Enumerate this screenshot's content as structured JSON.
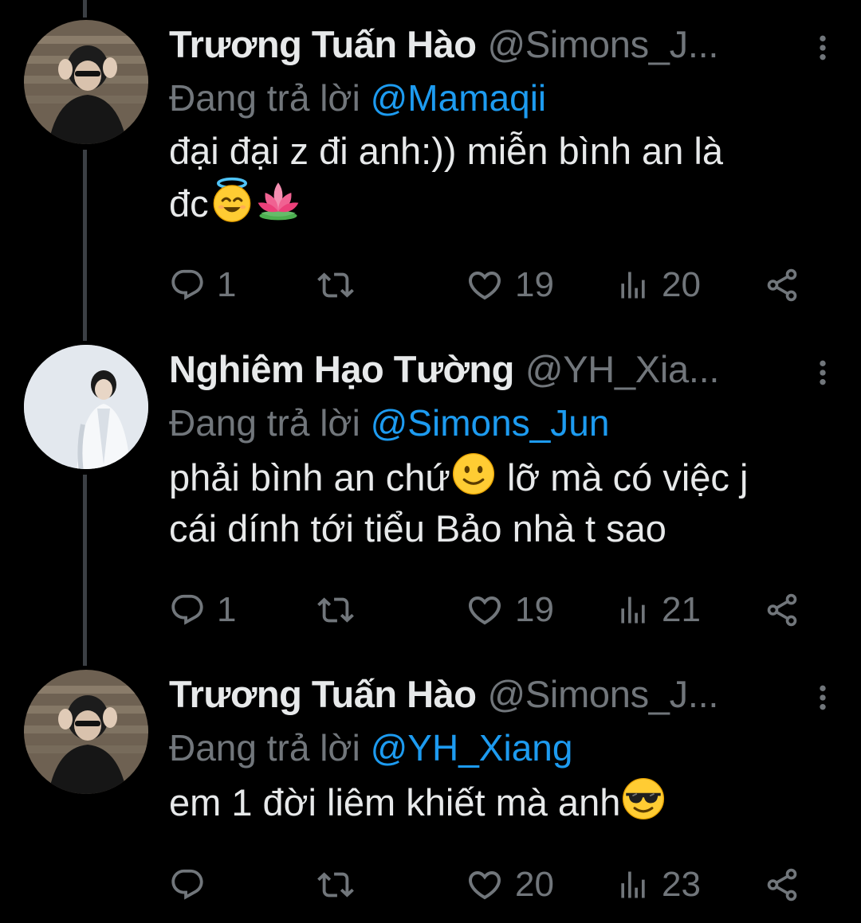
{
  "colors": {
    "background": "#000000",
    "text": "#e7e9ea",
    "muted": "#71767b",
    "mention": "#1d9bf0",
    "thread_line": "#3b3f44"
  },
  "reply_prefix": "Đang trả lời",
  "tweets": [
    {
      "display_name": "Trương Tuấn Hào",
      "handle": "@Simons_J...",
      "reply_to": "@Mamaqii",
      "text_line1": "đại đại z đi anh:)) miễn bình an là",
      "text_line2": "đc",
      "emojis": [
        "smiling-face-with-halo",
        "lotus"
      ],
      "replies": "1",
      "retweets": "",
      "likes": "19",
      "views": "20"
    },
    {
      "display_name": "Nghiêm Hạo Tường",
      "handle": "@YH_Xia...",
      "reply_to": "@Simons_Jun",
      "text_line1a": "phải bình an chứ",
      "text_line1b": " lỡ mà có việc j",
      "text_line2": "cái dính tới tiểu Bảo nhà t sao",
      "emojis": [
        "slightly-smiling-face"
      ],
      "replies": "1",
      "retweets": "",
      "likes": "19",
      "views": "21"
    },
    {
      "display_name": "Trương Tuấn Hào",
      "handle": "@Simons_J...",
      "reply_to": "@YH_Xiang",
      "text_line1": "em 1 đời liêm khiết mà anh",
      "emojis": [
        "smiling-face-with-sunglasses"
      ],
      "replies": "",
      "retweets": "",
      "likes": "20",
      "views": "23"
    }
  ]
}
